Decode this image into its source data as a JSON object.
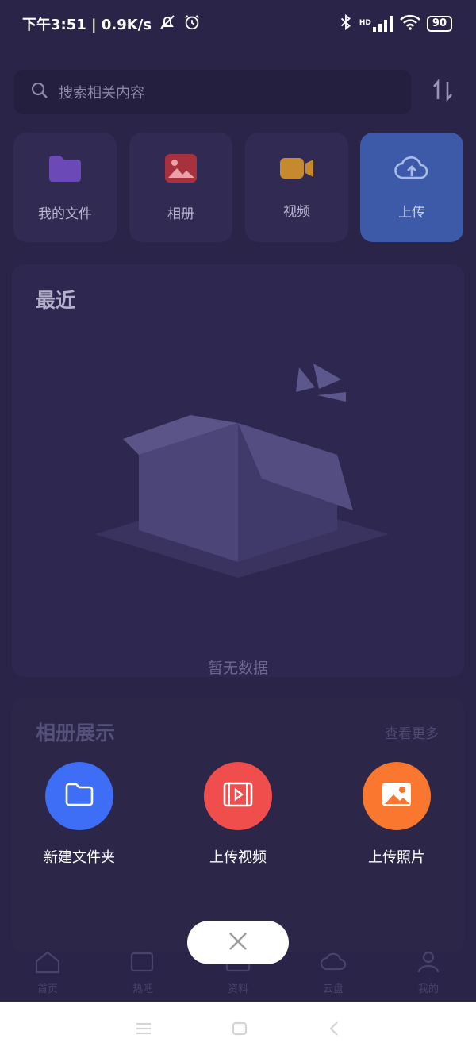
{
  "status_bar": {
    "time_speed": "下午3:51 | 0.9K/s",
    "hd": "HD",
    "battery": "90"
  },
  "search": {
    "placeholder": "搜索相关内容"
  },
  "tiles": [
    {
      "label": "我的文件",
      "icon": "folder-icon",
      "color": "#7a55c9"
    },
    {
      "label": "相册",
      "icon": "photo-album-icon",
      "color": "#c8414f"
    },
    {
      "label": "视频",
      "icon": "video-camera-icon",
      "color": "#e0a033"
    },
    {
      "label": "上传",
      "icon": "cloud-upload-icon",
      "color": "#3c5aa8"
    }
  ],
  "recent": {
    "title": "最近",
    "empty_text": "暂无数据"
  },
  "album": {
    "title": "相册展示",
    "more": "查看更多"
  },
  "bottom_nav": [
    {
      "label": "首页",
      "icon": "home-icon"
    },
    {
      "label": "热吧",
      "icon": "sparkle-chat-icon"
    },
    {
      "label": "资料",
      "icon": "folder-icon"
    },
    {
      "label": "云盘",
      "icon": "cloud-icon"
    },
    {
      "label": "我的",
      "icon": "person-icon"
    }
  ],
  "actions": [
    {
      "label": "新建文件夹",
      "icon": "folder-icon",
      "color": "#3d6ef5"
    },
    {
      "label": "上传视频",
      "icon": "video-play-icon",
      "color": "#f04d4d"
    },
    {
      "label": "上传照片",
      "icon": "image-icon",
      "color": "#f9772e"
    }
  ],
  "colors": {
    "background": "#2a2448",
    "card": "#2e2850",
    "close_button": "#ffffff"
  }
}
